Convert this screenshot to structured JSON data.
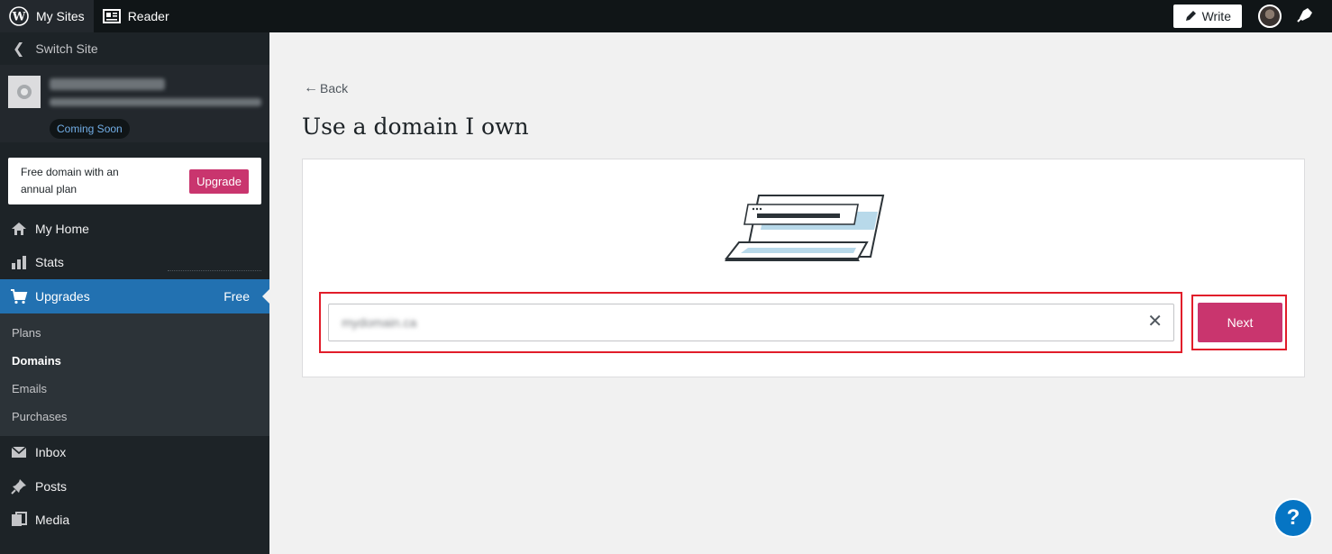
{
  "topbar": {
    "my_sites": "My Sites",
    "reader": "Reader",
    "write": "Write"
  },
  "sidebar": {
    "switch_site": "Switch Site",
    "site_badge": "Coming Soon",
    "upsell": {
      "text": "Free domain with an annual plan",
      "button": "Upgrade"
    },
    "items": [
      {
        "label": "My Home",
        "icon": "home-icon"
      },
      {
        "label": "Stats",
        "icon": "stats-icon"
      },
      {
        "label": "Upgrades",
        "icon": "cart-icon",
        "badge": "Free"
      }
    ],
    "submenu": [
      "Plans",
      "Domains",
      "Emails",
      "Purchases"
    ],
    "items_bottom": [
      {
        "label": "Inbox",
        "icon": "mail-icon"
      },
      {
        "label": "Posts",
        "icon": "pin-icon"
      },
      {
        "label": "Media",
        "icon": "media-icon"
      }
    ]
  },
  "main": {
    "back": "Back",
    "title": "Use a domain I own",
    "input_value": "mydomain.ca",
    "next": "Next",
    "help": "?"
  },
  "colors": {
    "accent_pink": "#c9356e",
    "active_blue": "#2271b1",
    "highlight_red": "#e11d2a"
  }
}
